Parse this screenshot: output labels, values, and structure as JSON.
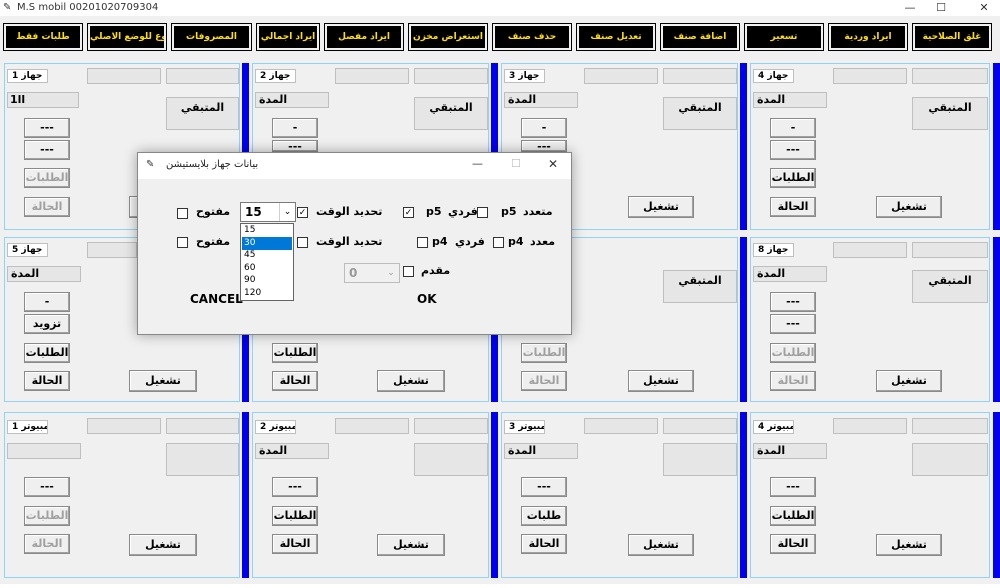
{
  "window": {
    "title": "M.S mobil 00201020709304",
    "minimize": "—",
    "maximize": "☐",
    "close": "✕"
  },
  "toolbar": [
    "غلق الصلاحية",
    "ايراد وردية",
    "تسعير",
    "اضافة صنف",
    "تعديل صنف",
    "حذف صنف",
    "استعراض مخزن",
    "ايراد مفصل",
    "ايراد اجمالي",
    "المصروفات",
    "رجوع للوضع الاصلي",
    "طلبات فقط"
  ],
  "labels": {
    "remaining": "المتبقي",
    "duration": "المدة",
    "minus": "-",
    "dashes": "---",
    "orders": "الطلبات",
    "orders_short": "طلبات",
    "status": "الحالة",
    "run": "تشغيل",
    "supply": "تزويد",
    "counter": "1ll"
  },
  "devices": {
    "d1": "جهاز 1",
    "d2": "جهاز 2",
    "d3": "جهاز 3",
    "d4": "جهاز 4",
    "d5": "جهاز 5",
    "d8": "جهاز 8",
    "c1": "كمبيوتر 1",
    "c2": "كمبيوتر 2",
    "c3": "كمبيوتر 3",
    "c4": "كمبيوتر 4"
  },
  "dialog": {
    "title": "بيانات جهاز بلايستيشن",
    "open": "مفتوح",
    "set_time": "تحديد الوقت",
    "single": "فردي",
    "multi": "متعدد",
    "multi_alt": "معدد",
    "p5": "p5",
    "p4": "p4",
    "advance": "مقدم",
    "cancel": "CANCEL",
    "ok": "OK",
    "time_value": "15",
    "advance_value": "0",
    "time_options": [
      "15",
      "30",
      "45",
      "60",
      "90",
      "120"
    ],
    "checked_set_time": "✓",
    "checked_p5": "✓"
  }
}
